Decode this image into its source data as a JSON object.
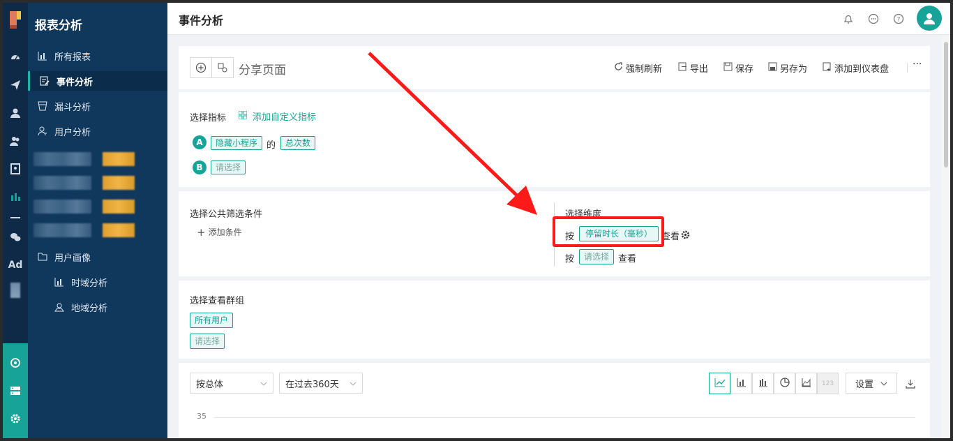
{
  "sidebar": {
    "title": "报表分析",
    "items": [
      {
        "label": "所有报表",
        "icon": "bar-chart-icon"
      },
      {
        "label": "事件分析",
        "icon": "edit-doc-icon",
        "active": true
      },
      {
        "label": "漏斗分析",
        "icon": "funnel-icon"
      },
      {
        "label": "用户分析",
        "icon": "user-icon"
      },
      {
        "label": "用户画像",
        "icon": "folder-icon"
      },
      {
        "label": "时域分析",
        "icon": "bar-chart-icon"
      },
      {
        "label": "地域分析",
        "icon": "map-pin-icon"
      }
    ]
  },
  "rail": {
    "icons": [
      "dashboard-icon",
      "send-icon",
      "user-icon",
      "users-icon",
      "contact-icon",
      "bar-chart-icon",
      "divider",
      "wechat-icon"
    ],
    "ad_label": "Ad",
    "bottom_icons": [
      "hub-icon",
      "server-icon",
      "gear-icon"
    ]
  },
  "header": {
    "title": "事件分析",
    "icons": [
      "bell-icon",
      "chat-icon",
      "help-icon"
    ],
    "avatar": "user-avatar-icon"
  },
  "toolbar": {
    "share_title": "分享页面",
    "actions": [
      {
        "label": "强制刷新",
        "icon": "refresh-icon"
      },
      {
        "label": "导出",
        "icon": "export-icon"
      },
      {
        "label": "保存",
        "icon": "save-icon"
      },
      {
        "label": "另存为",
        "icon": "save-as-icon"
      },
      {
        "label": "添加到仪表盘",
        "icon": "add-dashboard-icon"
      }
    ],
    "more": "···"
  },
  "metrics": {
    "label": "选择指标",
    "add_custom": "添加自定义指标",
    "row_a": {
      "badge": "A",
      "event": "隐藏小程序",
      "of": "的",
      "measure": "总次数"
    },
    "row_b": {
      "badge": "B",
      "placeholder": "请选择"
    }
  },
  "filters": {
    "label": "选择公共筛选条件",
    "add": "添加条件"
  },
  "dimensions": {
    "label": "选择维度",
    "row1": {
      "prefix": "按",
      "value": "停留时长（毫秒）",
      "suffix": "查看"
    },
    "row2": {
      "prefix": "按",
      "placeholder": "请选择",
      "suffix": "查看"
    }
  },
  "groups": {
    "label": "选择查看群组",
    "selected": "所有用户",
    "placeholder": "请选择"
  },
  "chart_controls": {
    "granularity": "按总体",
    "range": "在过去360天",
    "chart_types": [
      "line-chart-icon",
      "bar-chart-icon",
      "grouped-bar-icon",
      "pie-chart-icon",
      "area-chart-icon",
      "number-icon"
    ],
    "number_label": "123",
    "settings": "设置",
    "y_tick": "35"
  },
  "colors": {
    "accent": "#17a398",
    "sidebar": "#10375c",
    "annotation": "#ff1a1a"
  }
}
